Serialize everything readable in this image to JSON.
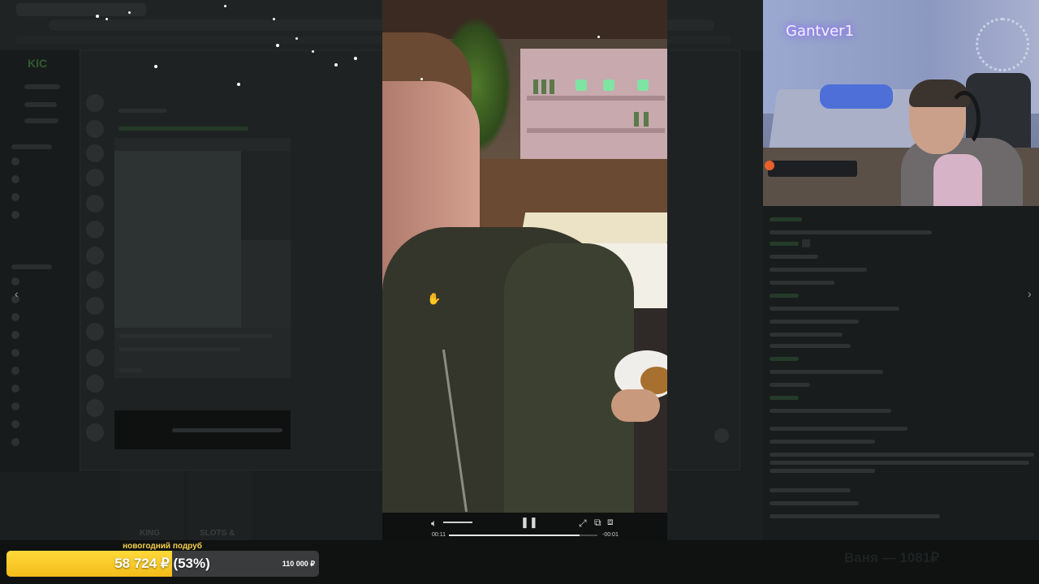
{
  "webcam": {
    "streamer_name": "Gantver1"
  },
  "video_player": {
    "current_time": "00:11",
    "remaining_time": "-00:01",
    "progress": 0.88,
    "volume_level": 0.6,
    "icons": {
      "volume": "volume-icon",
      "pause": "pause-icon",
      "expand": "expand-icon",
      "pip": "pip-icon",
      "cast": "cast-icon"
    }
  },
  "navigation": {
    "prev_label": "‹",
    "next_label": "›"
  },
  "donation_goal": {
    "title": "новогодний подруб",
    "amount": "58 724 ₽ (53%)",
    "target": "110 000 ₽",
    "progress": 0.53,
    "fill_color": "#f5c924"
  },
  "top_donor": {
    "text": "Ваня — 1081₽"
  },
  "background_page": {
    "logo": "KIC",
    "game_labels": [
      "KING",
      "SLOTS &"
    ]
  }
}
